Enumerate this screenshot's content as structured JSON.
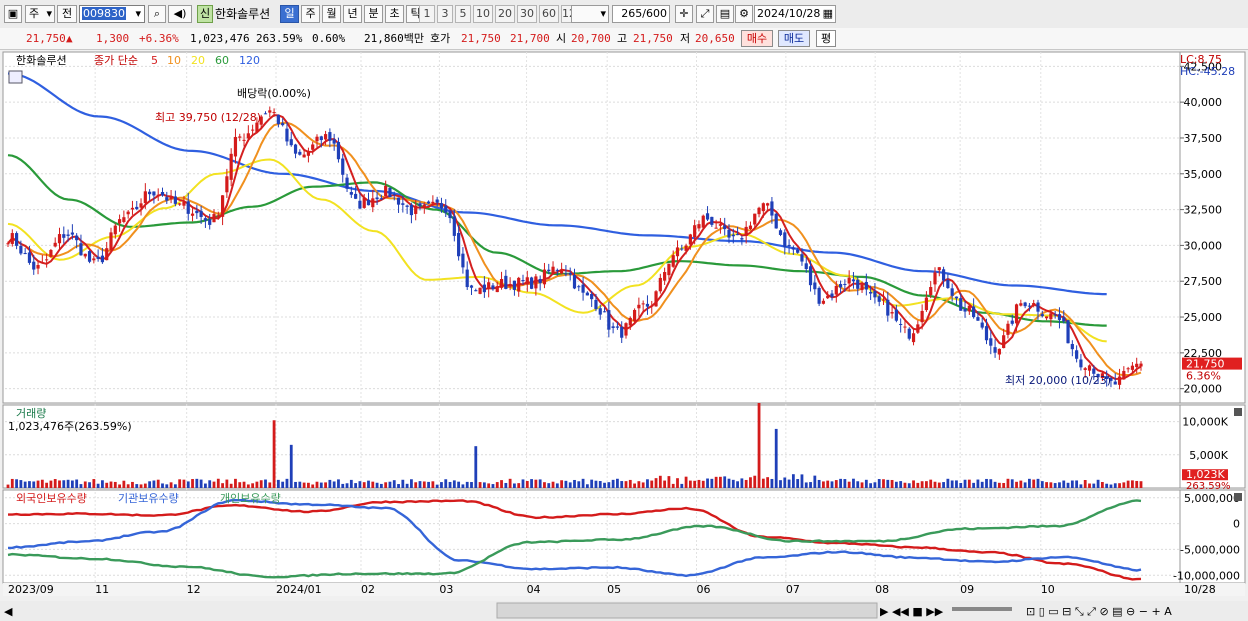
{
  "toolbar": {
    "market": "주",
    "scope": "전",
    "code": "009830",
    "name": "한화솔루션",
    "tag": "신",
    "period_tabs": [
      "일",
      "주",
      "월",
      "년",
      "분",
      "초",
      "틱"
    ],
    "active_period": "일",
    "interval_buttons": [
      "1",
      "3",
      "5",
      "10",
      "20",
      "30",
      "60",
      "120"
    ],
    "count_value": "265",
    "count_max": "/600",
    "date": "2024/10/28"
  },
  "quote": {
    "price": "21,750",
    "arrow": "▲",
    "change": "1,300",
    "change_pct": "+6.36%",
    "volume": "1,023,476",
    "volume_ratio": "263.59%",
    "turnover": "0.60%",
    "amount": "21,860백만",
    "ask_label": "호가",
    "ask": "21,750",
    "bid": "21,700",
    "open_label": "시",
    "open": "20,700",
    "high_label": "고",
    "high": "21,750",
    "low_label": "저",
    "low": "20,650",
    "buy_label": "매수",
    "sell_label": "매도",
    "eval_label": "평"
  },
  "colors": {
    "up": "#d41b1b",
    "down": "#1f3fb8",
    "ma5": "#d42020",
    "ma10": "#f0901e",
    "ma20": "#f2e221",
    "ma60": "#2a9a3a",
    "ma120": "#2f5fe0",
    "foreign": "#d41b1b",
    "institution": "#3565d8",
    "individual": "#3a9a5a"
  },
  "chart_data": [
    {
      "type": "candlestick",
      "title": "한화솔루션",
      "legend": [
        "종가 단순",
        "5",
        "10",
        "20",
        "60",
        "120"
      ],
      "ylim": [
        19000,
        43500
      ],
      "yticks": [
        20000,
        22500,
        25000,
        27500,
        30000,
        32500,
        35000,
        37500,
        40000,
        42500
      ],
      "ytick_labels": [
        "20,000",
        "22,500",
        "25,000",
        "27,500",
        "30,000",
        "32,500",
        "35,000",
        "37,500",
        "40,000",
        "42,500"
      ],
      "x_labels": [
        "2023/09",
        "11",
        "12",
        "2024/01",
        "02",
        "03",
        "04",
        "05",
        "06",
        "07",
        "08",
        "09",
        "10",
        "10/28"
      ],
      "close_anchors": [
        {
          "x": "2023/09",
          "value": 30600
        },
        {
          "x": "2023/09 mid",
          "value": 28400
        },
        {
          "x": "2023/10",
          "value": 30800
        },
        {
          "x": "2023/10 mid",
          "value": 28700
        },
        {
          "x": "2023/10 late",
          "value": 31900
        },
        {
          "x": "2023/11 mid",
          "value": 33800
        },
        {
          "x": "2023/12",
          "value": 32700
        },
        {
          "x": "2023/12 mid",
          "value": 31700
        },
        {
          "x": "2023/12 late",
          "value": 37600
        },
        {
          "x": "2023/12/28",
          "value": 39400
        },
        {
          "x": "2024/01 early",
          "value": 36200
        },
        {
          "x": "2024/01 mid",
          "value": 37600
        },
        {
          "x": "2024/01 late",
          "value": 32900
        },
        {
          "x": "2024/02 early",
          "value": 33700
        },
        {
          "x": "2024/02 mid",
          "value": 32400
        },
        {
          "x": "2024/02 late",
          "value": 32800
        },
        {
          "x": "2024/03 early",
          "value": 26800
        },
        {
          "x": "2024/03 mid",
          "value": 27300
        },
        {
          "x": "2024/04 early",
          "value": 27400
        },
        {
          "x": "2024/04 mid",
          "value": 28500
        },
        {
          "x": "2024/04 late",
          "value": 26300
        },
        {
          "x": "2024/05 early",
          "value": 23900
        },
        {
          "x": "2024/05 mid",
          "value": 25800
        },
        {
          "x": "2024/05 late",
          "value": 29500
        },
        {
          "x": "2024/06 early",
          "value": 31900
        },
        {
          "x": "2024/06 mid",
          "value": 30300
        },
        {
          "x": "2024/06 late",
          "value": 32700
        },
        {
          "x": "2024/07 early",
          "value": 29700
        },
        {
          "x": "2024/07 mid",
          "value": 26300
        },
        {
          "x": "2024/07 late",
          "value": 27600
        },
        {
          "x": "2024/08 early",
          "value": 25900
        },
        {
          "x": "2024/08 mid",
          "value": 23900
        },
        {
          "x": "2024/08 late",
          "value": 28100
        },
        {
          "x": "2024/09 early",
          "value": 25400
        },
        {
          "x": "2024/09 mid",
          "value": 22900
        },
        {
          "x": "2024/09 late",
          "value": 26100
        },
        {
          "x": "2024/10 early",
          "value": 25100
        },
        {
          "x": "2024/10 mid",
          "value": 21900
        },
        {
          "x": "2024/10/23",
          "value": 20300
        },
        {
          "x": "2024/10/28",
          "value": 21750
        }
      ],
      "ma_anchors": {
        "ma20": [
          31500,
          29000,
          30600,
          32600,
          35000,
          36000,
          33200,
          31000,
          27600,
          27800,
          26700,
          25300,
          27200,
          29900,
          30800,
          29400,
          27900,
          25800,
          26300,
          25200,
          25100,
          23300
        ],
        "ma60": [
          36300,
          33200,
          31300,
          31600,
          32700,
          34100,
          34400,
          32500,
          29500,
          28000,
          28200,
          28900,
          28600,
          28200,
          27800,
          26500,
          25300,
          24700,
          24400
        ],
        "ma120": [
          42000,
          39000,
          36600,
          35000,
          33800,
          32300,
          31400,
          30700,
          30300,
          29500,
          28200,
          27200,
          26600
        ]
      },
      "annotations": {
        "dividend": "배당락(0.00%)",
        "high": "최고 39,750 (12/28)",
        "low": "최저 20,000 (10/23)",
        "lc": "LC:8.75",
        "hc": "HC:-45.28",
        "last_price": "21,750",
        "last_pct": "6.36%"
      }
    },
    {
      "type": "bar",
      "title": "거래량",
      "summary": "1,023,476주(263.59%)",
      "ylim": [
        0,
        12500
      ],
      "yticks": [
        5000,
        10000
      ],
      "ytick_labels": [
        "5,000K",
        "10,000K"
      ],
      "last_label": "1,023K",
      "last_pct": "263.59%",
      "spikes": [
        {
          "x": "2023/12/28",
          "value": 10200
        },
        {
          "x": "2024/01 early",
          "value": 6500
        },
        {
          "x": "2024/02 late",
          "value": 6300
        },
        {
          "x": "2024/05 late",
          "value": 12800
        },
        {
          "x": "2024/06 early",
          "value": 8900
        }
      ]
    },
    {
      "type": "line",
      "series_names": [
        "외국인보유수량",
        "기관보유수량",
        "개인보유수량"
      ],
      "ylim": [
        -11500000,
        6500000
      ],
      "yticks": [
        5000000,
        0,
        -5000000,
        -10000000
      ],
      "ytick_labels": [
        "5,000,000",
        "0",
        "-5,000,000",
        "-10,000,000"
      ],
      "series": [
        {
          "name": "외국인보유수량",
          "anchors": [
            1800000,
            1900000,
            1600000,
            3500000,
            2300000,
            4200000,
            4400000,
            1200000,
            1800000,
            2900000,
            -2600000,
            -3800000,
            -4600000,
            -5600000,
            -7800000,
            -10800000
          ]
        },
        {
          "name": "기관보유수량",
          "anchors": [
            -4600000,
            -3500000,
            -1600000,
            4500000,
            3700000,
            3000000,
            -7200000,
            -8800000,
            -8500000,
            -10000000,
            -6600000,
            -5500000,
            -6600000,
            -7400000,
            -6500000,
            -9000000
          ]
        },
        {
          "name": "개인보유수량",
          "anchors": [
            -6000000,
            -6800000,
            -8300000,
            -10300000,
            -9700000,
            -9700000,
            -3600000,
            -3100000,
            -500000,
            -3400000,
            -3400000,
            -1000000,
            -500000,
            4400000
          ]
        }
      ]
    }
  ]
}
